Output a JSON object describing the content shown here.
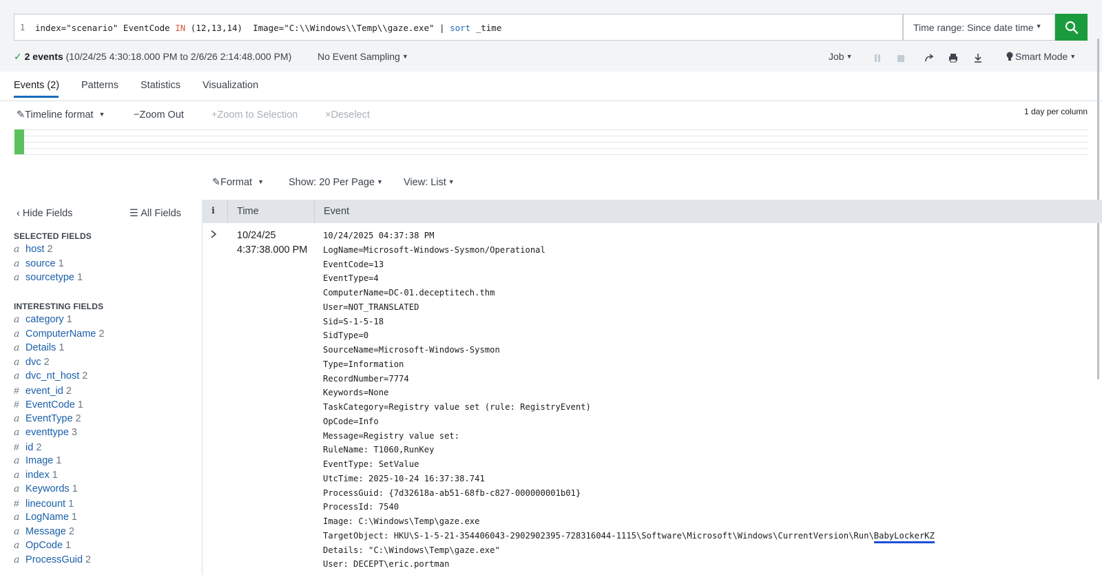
{
  "search": {
    "line_number": "1",
    "query_parts": {
      "p1": "index=\"scenario\" EventCode ",
      "in": "IN",
      "p2": " (12,13,14)  Image=\"C:\\\\Windows\\\\Temp\\\\gaze.exe\" | ",
      "sort": "sort",
      "p3": " _time"
    },
    "time_range": "Time range: Since date time",
    "search_icon": "search-icon"
  },
  "status": {
    "events_count": "2 events",
    "events_range": "(10/24/25 4:30:18.000 PM to 2/6/26 2:14:48.000 PM)",
    "sampling": "No Event Sampling",
    "job": "Job",
    "smart_mode": "Smart Mode"
  },
  "tabs": [
    {
      "label": "Events (2)"
    },
    {
      "label": "Patterns"
    },
    {
      "label": "Statistics"
    },
    {
      "label": "Visualization"
    }
  ],
  "timeline": {
    "format": "Timeline format",
    "zoom_out": "Zoom Out",
    "zoom_selection": "Zoom to Selection",
    "deselect": "Deselect",
    "scale": "1 day per column"
  },
  "results_toolbar": {
    "format": "Format",
    "show": "Show: 20 Per Page",
    "view": "View: List"
  },
  "sidebar": {
    "hide_fields": "Hide Fields",
    "all_fields": "All Fields",
    "selected_title": "SELECTED FIELDS",
    "selected": [
      {
        "type": "a",
        "name": "host",
        "count": "2"
      },
      {
        "type": "a",
        "name": "source",
        "count": "1"
      },
      {
        "type": "a",
        "name": "sourcetype",
        "count": "1"
      }
    ],
    "interesting_title": "INTERESTING FIELDS",
    "interesting": [
      {
        "type": "a",
        "name": "category",
        "count": "1"
      },
      {
        "type": "a",
        "name": "ComputerName",
        "count": "2"
      },
      {
        "type": "a",
        "name": "Details",
        "count": "1"
      },
      {
        "type": "a",
        "name": "dvc",
        "count": "2"
      },
      {
        "type": "a",
        "name": "dvc_nt_host",
        "count": "2"
      },
      {
        "type": "#",
        "name": "event_id",
        "count": "2"
      },
      {
        "type": "#",
        "name": "EventCode",
        "count": "1"
      },
      {
        "type": "a",
        "name": "EventType",
        "count": "2"
      },
      {
        "type": "a",
        "name": "eventtype",
        "count": "3"
      },
      {
        "type": "#",
        "name": "id",
        "count": "2"
      },
      {
        "type": "a",
        "name": "Image",
        "count": "1"
      },
      {
        "type": "a",
        "name": "index",
        "count": "1"
      },
      {
        "type": "a",
        "name": "Keywords",
        "count": "1"
      },
      {
        "type": "#",
        "name": "linecount",
        "count": "1"
      },
      {
        "type": "a",
        "name": "LogName",
        "count": "1"
      },
      {
        "type": "a",
        "name": "Message",
        "count": "2"
      },
      {
        "type": "a",
        "name": "OpCode",
        "count": "1"
      },
      {
        "type": "a",
        "name": "ProcessGuid",
        "count": "2"
      }
    ]
  },
  "table": {
    "col_info": "i",
    "col_time": "Time",
    "col_event": "Event",
    "row_time_line1": "10/24/25",
    "row_time_line2": "4:37:38.000 PM",
    "event_lines": [
      "10/24/2025 04:37:38 PM",
      "LogName=Microsoft-Windows-Sysmon/Operational",
      "EventCode=13",
      "EventType=4",
      "ComputerName=DC-01.deceptitech.thm",
      "User=NOT_TRANSLATED",
      "Sid=S-1-5-18",
      "SidType=0",
      "SourceName=Microsoft-Windows-Sysmon",
      "Type=Information",
      "RecordNumber=7774",
      "Keywords=None",
      "TaskCategory=Registry value set (rule: RegistryEvent)",
      "OpCode=Info",
      "Message=Registry value set:",
      "RuleName: T1060,RunKey",
      "EventType: SetValue",
      "UtcTime: 2025-10-24 16:37:38.741",
      "ProcessGuid: {7d32618a-ab51-68fb-c827-000000001b01}",
      "ProcessId: 7540",
      "Image: C:\\Windows\\Temp\\gaze.exe"
    ],
    "target_object_prefix": "TargetObject: HKU\\S-1-5-21-354406043-2902902395-728316044-1115\\Software\\Microsoft\\Windows\\CurrentVersion\\Run\\",
    "target_object_highlight": "BabyLockerKZ",
    "event_tail": [
      "Details: \"C:\\Windows\\Temp\\gaze.exe\"",
      "User: DECEPT\\eric.portman"
    ]
  }
}
